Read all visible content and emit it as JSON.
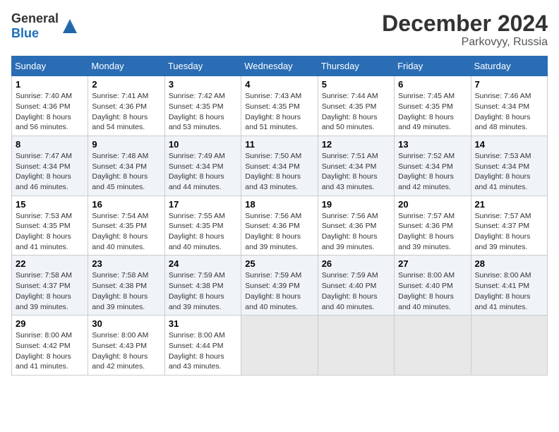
{
  "header": {
    "logo": {
      "general": "General",
      "blue": "Blue"
    },
    "title": "December 2024",
    "location": "Parkovyy, Russia"
  },
  "weekdays": [
    "Sunday",
    "Monday",
    "Tuesday",
    "Wednesday",
    "Thursday",
    "Friday",
    "Saturday"
  ],
  "weeks": [
    [
      {
        "day": "1",
        "sunrise": "7:40 AM",
        "sunset": "4:36 PM",
        "daylight": "8 hours and 56 minutes."
      },
      {
        "day": "2",
        "sunrise": "7:41 AM",
        "sunset": "4:36 PM",
        "daylight": "8 hours and 54 minutes."
      },
      {
        "day": "3",
        "sunrise": "7:42 AM",
        "sunset": "4:35 PM",
        "daylight": "8 hours and 53 minutes."
      },
      {
        "day": "4",
        "sunrise": "7:43 AM",
        "sunset": "4:35 PM",
        "daylight": "8 hours and 51 minutes."
      },
      {
        "day": "5",
        "sunrise": "7:44 AM",
        "sunset": "4:35 PM",
        "daylight": "8 hours and 50 minutes."
      },
      {
        "day": "6",
        "sunrise": "7:45 AM",
        "sunset": "4:35 PM",
        "daylight": "8 hours and 49 minutes."
      },
      {
        "day": "7",
        "sunrise": "7:46 AM",
        "sunset": "4:34 PM",
        "daylight": "8 hours and 48 minutes."
      }
    ],
    [
      {
        "day": "8",
        "sunrise": "7:47 AM",
        "sunset": "4:34 PM",
        "daylight": "8 hours and 46 minutes."
      },
      {
        "day": "9",
        "sunrise": "7:48 AM",
        "sunset": "4:34 PM",
        "daylight": "8 hours and 45 minutes."
      },
      {
        "day": "10",
        "sunrise": "7:49 AM",
        "sunset": "4:34 PM",
        "daylight": "8 hours and 44 minutes."
      },
      {
        "day": "11",
        "sunrise": "7:50 AM",
        "sunset": "4:34 PM",
        "daylight": "8 hours and 43 minutes."
      },
      {
        "day": "12",
        "sunrise": "7:51 AM",
        "sunset": "4:34 PM",
        "daylight": "8 hours and 43 minutes."
      },
      {
        "day": "13",
        "sunrise": "7:52 AM",
        "sunset": "4:34 PM",
        "daylight": "8 hours and 42 minutes."
      },
      {
        "day": "14",
        "sunrise": "7:53 AM",
        "sunset": "4:34 PM",
        "daylight": "8 hours and 41 minutes."
      }
    ],
    [
      {
        "day": "15",
        "sunrise": "7:53 AM",
        "sunset": "4:35 PM",
        "daylight": "8 hours and 41 minutes."
      },
      {
        "day": "16",
        "sunrise": "7:54 AM",
        "sunset": "4:35 PM",
        "daylight": "8 hours and 40 minutes."
      },
      {
        "day": "17",
        "sunrise": "7:55 AM",
        "sunset": "4:35 PM",
        "daylight": "8 hours and 40 minutes."
      },
      {
        "day": "18",
        "sunrise": "7:56 AM",
        "sunset": "4:36 PM",
        "daylight": "8 hours and 39 minutes."
      },
      {
        "day": "19",
        "sunrise": "7:56 AM",
        "sunset": "4:36 PM",
        "daylight": "8 hours and 39 minutes."
      },
      {
        "day": "20",
        "sunrise": "7:57 AM",
        "sunset": "4:36 PM",
        "daylight": "8 hours and 39 minutes."
      },
      {
        "day": "21",
        "sunrise": "7:57 AM",
        "sunset": "4:37 PM",
        "daylight": "8 hours and 39 minutes."
      }
    ],
    [
      {
        "day": "22",
        "sunrise": "7:58 AM",
        "sunset": "4:37 PM",
        "daylight": "8 hours and 39 minutes."
      },
      {
        "day": "23",
        "sunrise": "7:58 AM",
        "sunset": "4:38 PM",
        "daylight": "8 hours and 39 minutes."
      },
      {
        "day": "24",
        "sunrise": "7:59 AM",
        "sunset": "4:38 PM",
        "daylight": "8 hours and 39 minutes."
      },
      {
        "day": "25",
        "sunrise": "7:59 AM",
        "sunset": "4:39 PM",
        "daylight": "8 hours and 40 minutes."
      },
      {
        "day": "26",
        "sunrise": "7:59 AM",
        "sunset": "4:40 PM",
        "daylight": "8 hours and 40 minutes."
      },
      {
        "day": "27",
        "sunrise": "8:00 AM",
        "sunset": "4:40 PM",
        "daylight": "8 hours and 40 minutes."
      },
      {
        "day": "28",
        "sunrise": "8:00 AM",
        "sunset": "4:41 PM",
        "daylight": "8 hours and 41 minutes."
      }
    ],
    [
      {
        "day": "29",
        "sunrise": "8:00 AM",
        "sunset": "4:42 PM",
        "daylight": "8 hours and 41 minutes."
      },
      {
        "day": "30",
        "sunrise": "8:00 AM",
        "sunset": "4:43 PM",
        "daylight": "8 hours and 42 minutes."
      },
      {
        "day": "31",
        "sunrise": "8:00 AM",
        "sunset": "4:44 PM",
        "daylight": "8 hours and 43 minutes."
      },
      null,
      null,
      null,
      null
    ]
  ],
  "labels": {
    "sunrise": "Sunrise:",
    "sunset": "Sunset:",
    "daylight": "Daylight:"
  }
}
